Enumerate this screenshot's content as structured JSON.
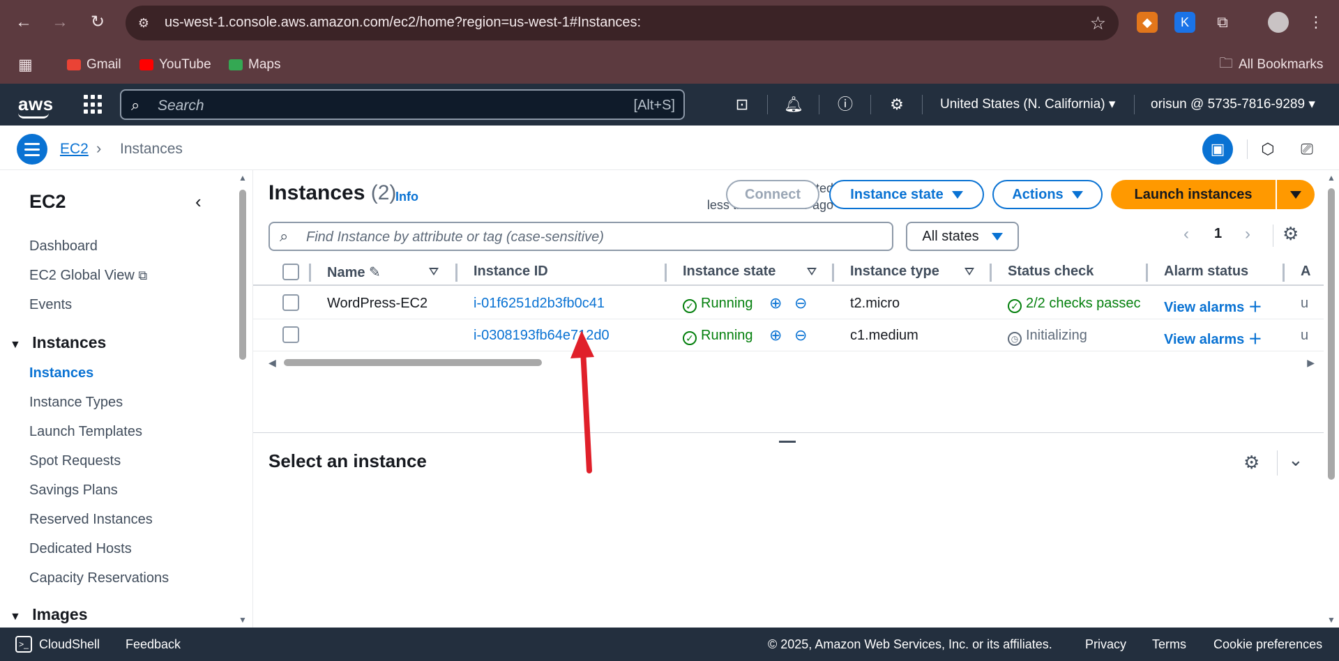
{
  "browser": {
    "url": "us-west-1.console.aws.amazon.com/ec2/home?region=us-west-1#Instances:",
    "bookmarks": [
      "Gmail",
      "YouTube",
      "Maps"
    ],
    "all_bookmarks": "All Bookmarks",
    "profile_initial": "K"
  },
  "aws_nav": {
    "logo": "aws",
    "search_placeholder": "Search",
    "search_shortcut": "[Alt+S]",
    "region": "United States (N. California) ▾",
    "account": "orisun @ 5735-7816-9289 ▾"
  },
  "breadcrumb": {
    "root": "EC2",
    "current": "Instances"
  },
  "sidebar": {
    "title": "EC2",
    "top_items": [
      "Dashboard",
      "EC2 Global View",
      "Events"
    ],
    "section_instances": "Instances",
    "instances_items": [
      "Instances",
      "Instance Types",
      "Launch Templates",
      "Spot Requests",
      "Savings Plans",
      "Reserved Instances",
      "Dedicated Hosts",
      "Capacity Reservations"
    ],
    "section_images": "Images"
  },
  "main": {
    "title": "Instances",
    "count": "(2)",
    "info": "Info",
    "last_updated_line1": "Last updated",
    "last_updated_line2": "less than a minute ago",
    "connect": "Connect",
    "instance_state": "Instance state",
    "actions": "Actions",
    "launch": "Launch instances",
    "filter_placeholder": "Find Instance by attribute or tag (case-sensitive)",
    "states_filter": "All states",
    "page": "1",
    "detail_title": "Select an instance"
  },
  "table": {
    "headers": [
      "Name",
      "Instance ID",
      "Instance state",
      "Instance type",
      "Status check",
      "Alarm status",
      "A"
    ],
    "rows": [
      {
        "name": "WordPress-EC2",
        "id": "i-01f6251d2b3fb0c41",
        "state": "Running",
        "type": "t2.micro",
        "status": "2/2 checks passec",
        "alarm": "View alarms",
        "extra": "u"
      },
      {
        "name": "",
        "id": "i-0308193fb64e712d0",
        "state": "Running",
        "type": "c1.medium",
        "status": "Initializing",
        "alarm": "View alarms",
        "extra": "u"
      }
    ]
  },
  "footer": {
    "cloudshell": "CloudShell",
    "feedback": "Feedback",
    "copyright": "© 2025, Amazon Web Services, Inc. or its affiliates.",
    "privacy": "Privacy",
    "terms": "Terms",
    "cookies": "Cookie preferences"
  },
  "colors": {
    "chrome": "#5c3a3f",
    "aws_nav": "#232f3e",
    "link": "#0972d3",
    "running": "#037f0c",
    "launch": "#ff9900",
    "annotation_arrow": "#e0202a"
  }
}
